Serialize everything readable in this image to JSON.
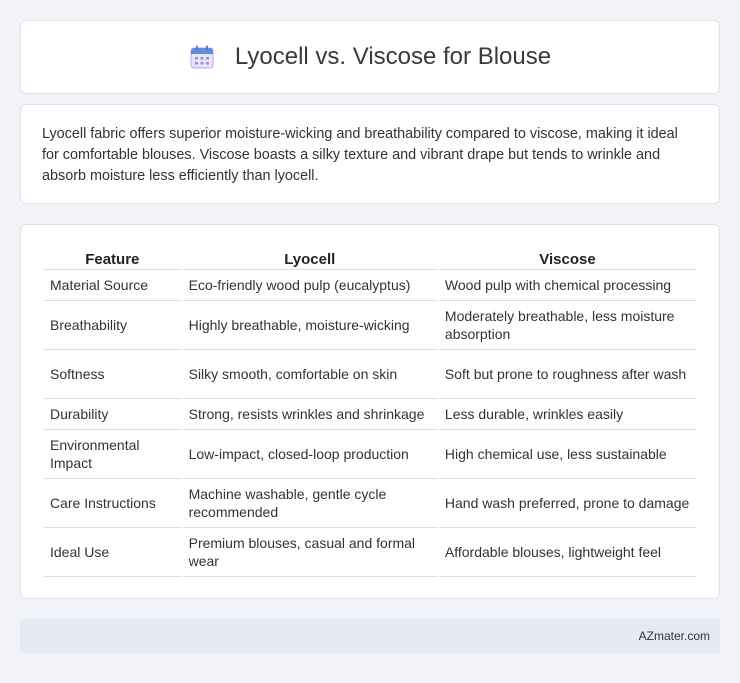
{
  "header": {
    "title": "Lyocell vs. Viscose for Blouse",
    "icon": "calendar-icon"
  },
  "intro": {
    "text": "Lyocell fabric offers superior moisture-wicking and breathability compared to viscose, making it ideal for comfortable blouses. Viscose boasts a silky texture and vibrant drape but tends to wrinkle and absorb moisture less efficiently than lyocell."
  },
  "table": {
    "headers": [
      "Feature",
      "Lyocell",
      "Viscose"
    ],
    "rows": [
      [
        "Material Source",
        "Eco-friendly wood pulp (eucalyptus)",
        "Wood pulp with chemical processing"
      ],
      [
        "Breathability",
        "Highly breathable, moisture-wicking",
        "Moderately breathable, less moisture absorption"
      ],
      [
        "Softness",
        "Silky smooth, comfortable on skin",
        "Soft but prone to roughness after wash"
      ],
      [
        "Durability",
        "Strong, resists wrinkles and shrinkage",
        "Less durable, wrinkles easily"
      ],
      [
        "Environmental Impact",
        "Low-impact, closed-loop production",
        "High chemical use, less sustainable"
      ],
      [
        "Care Instructions",
        "Machine washable, gentle cycle recommended",
        "Hand wash preferred, prone to damage"
      ],
      [
        "Ideal Use",
        "Premium blouses, casual and formal wear",
        "Affordable blouses, lightweight feel"
      ]
    ]
  },
  "footer": {
    "brand": "AZmater.com"
  },
  "colors": {
    "background": "#f1f3f8",
    "card": "#ffffff",
    "footer_bar": "#e6eaf4",
    "border": "#dfe3ea"
  }
}
